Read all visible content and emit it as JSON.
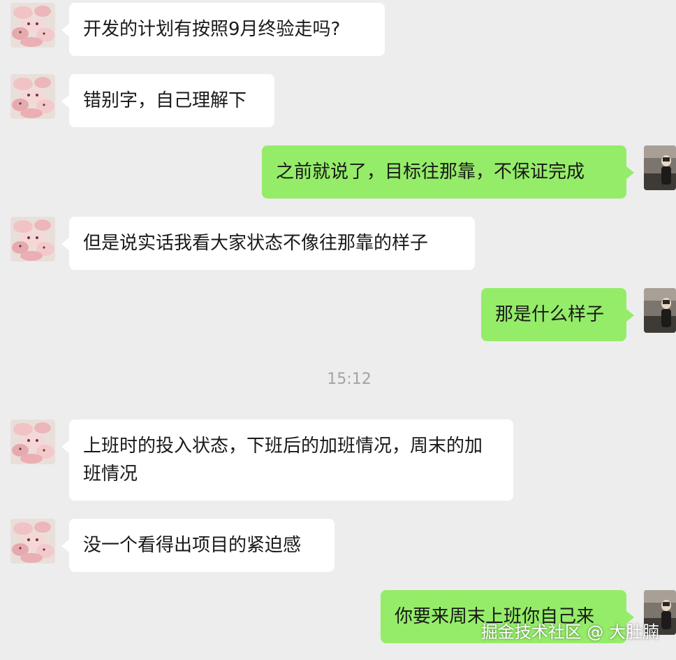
{
  "chat": {
    "messages": [
      {
        "side": "left",
        "text": "开发的计划有按照9月终验走吗?"
      },
      {
        "side": "left",
        "text": "错别字，自己理解下"
      },
      {
        "side": "right",
        "text": "之前就说了，目标往那靠，不保证完成"
      },
      {
        "side": "left",
        "text": "但是说实话我看大家状态不像往那靠的样子"
      },
      {
        "side": "right",
        "text": "那是什么样子"
      },
      {
        "side": "left",
        "text": "上班时的投入状态，下班后的加班情况，周末的加班情况"
      },
      {
        "side": "left",
        "text": "没一个看得出项目的紧迫感"
      },
      {
        "side": "right",
        "text": "你要来周末上班你自己来"
      }
    ],
    "timestamp": "15:12"
  },
  "watermark": "掘金技术社区 @ 大肚腩",
  "colors": {
    "background": "#ededed",
    "incoming_bubble": "#ffffff",
    "outgoing_bubble": "#95ec69",
    "text": "#191919",
    "timestamp": "#a3a3a3"
  },
  "icons": {
    "sender_avatar": "pink-plush-avatar",
    "self_avatar": "person-photo-avatar"
  }
}
